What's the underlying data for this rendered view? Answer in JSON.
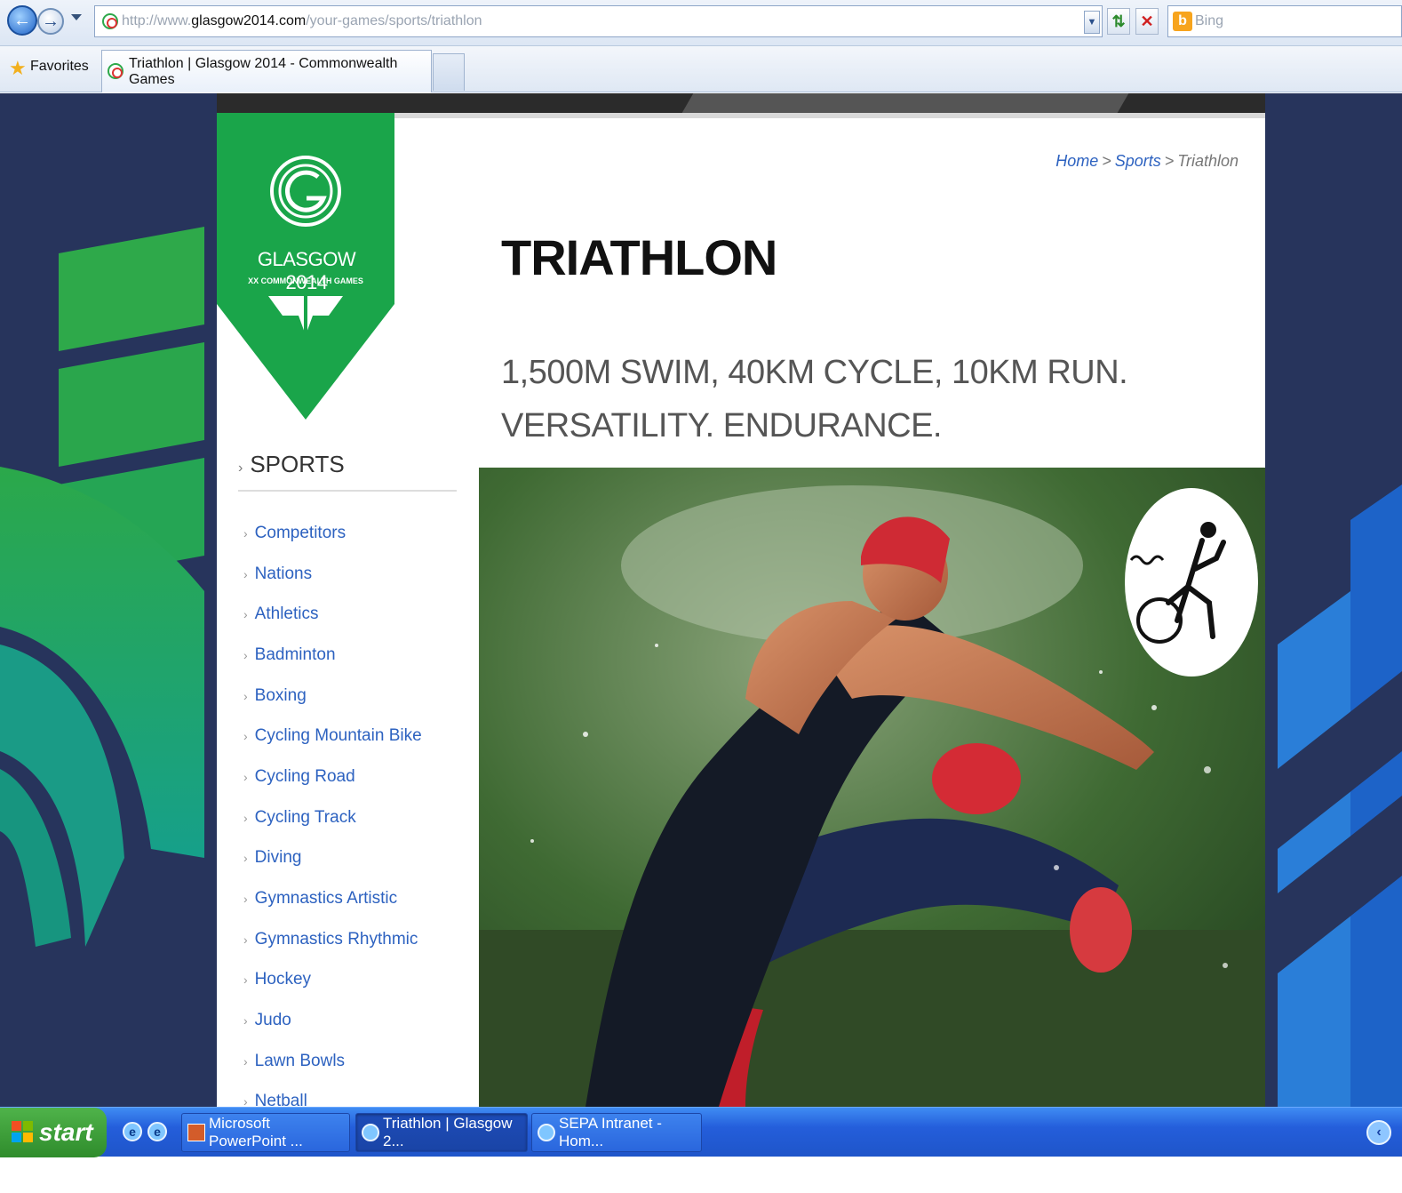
{
  "browser": {
    "url_prefix": "http://www.",
    "url_host": "glasgow2014.com",
    "url_path": "/your-games/sports/triathlon",
    "search_placeholder": "Bing",
    "favorites_label": "Favorites",
    "tab_title": "Triathlon | Glasgow 2014 - Commonwealth Games"
  },
  "logo": {
    "name": "GLASGOW 2014",
    "tagline": "XX COMMONWEALTH GAMES",
    "letter": "G"
  },
  "breadcrumb": {
    "home": "Home",
    "sep1": ">",
    "sports": "Sports",
    "sep2": ">",
    "current": "Triathlon"
  },
  "page": {
    "title": "TRIATHLON",
    "subtitle": "1,500M SWIM, 40KM CYCLE, 10KM RUN. VERSATILITY. ENDURANCE."
  },
  "sidebar": {
    "heading": "SPORTS",
    "heading_arrow": "›",
    "items": [
      {
        "label": "Competitors"
      },
      {
        "label": "Nations"
      },
      {
        "label": "Athletics"
      },
      {
        "label": "Badminton"
      },
      {
        "label": "Boxing"
      },
      {
        "label": "Cycling Mountain Bike"
      },
      {
        "label": "Cycling Road"
      },
      {
        "label": "Cycling Track"
      },
      {
        "label": "Diving"
      },
      {
        "label": "Gymnastics Artistic"
      },
      {
        "label": "Gymnastics Rhythmic"
      },
      {
        "label": "Hockey"
      },
      {
        "label": "Judo"
      },
      {
        "label": "Lawn Bowls"
      },
      {
        "label": "Netball"
      }
    ]
  },
  "taskbar": {
    "start_label": "start",
    "tasks": [
      {
        "label": "Microsoft PowerPoint ..."
      },
      {
        "label": "Triathlon | Glasgow 2..."
      },
      {
        "label": "SEPA Intranet - Hom..."
      }
    ]
  },
  "colors": {
    "brand_green": "#1aa54a",
    "page_navy": "#27345c",
    "link_blue": "#2d62c0",
    "taskbar_blue": "#245edb"
  }
}
